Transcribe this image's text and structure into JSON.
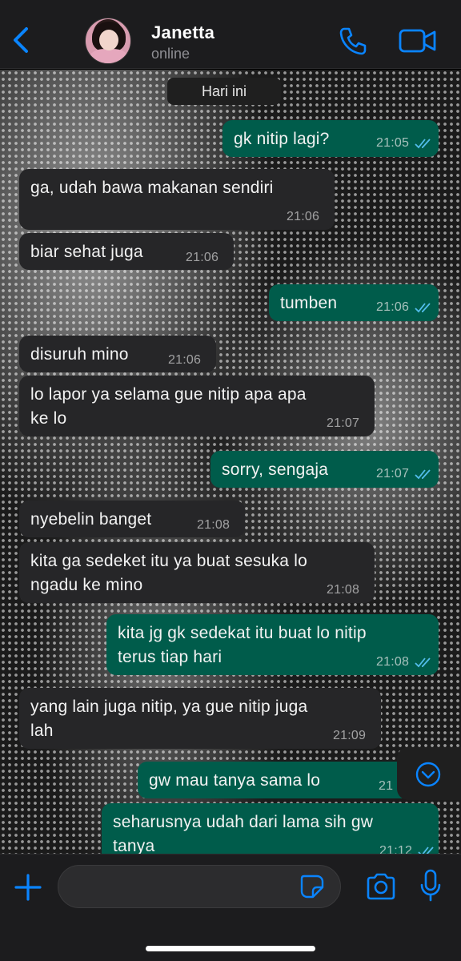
{
  "header": {
    "back_icon": "chevron-left-icon",
    "contact_name": "Janetta",
    "contact_status": "online",
    "call_icon": "phone-icon",
    "video_icon": "video-camera-icon",
    "accent_color": "#0a84ff"
  },
  "chat": {
    "date_label": "Hari ini",
    "messages": [
      {
        "direction": "out",
        "text": "gk nitip lagi?",
        "time": "21:05",
        "read": true
      },
      {
        "direction": "in",
        "text": "ga, udah bawa makanan sendiri",
        "time": "21:06"
      },
      {
        "direction": "in",
        "text": "biar sehat juga",
        "time": "21:06"
      },
      {
        "direction": "out",
        "text": "tumben",
        "time": "21:06",
        "read": true
      },
      {
        "direction": "in",
        "text": "disuruh mino",
        "time": "21:06"
      },
      {
        "direction": "in",
        "text": "lo lapor ya selama gue nitip apa apa\nke lo",
        "time": "21:07"
      },
      {
        "direction": "out",
        "text": "sorry, sengaja",
        "time": "21:07",
        "read": true
      },
      {
        "direction": "in",
        "text": "nyebelin banget",
        "time": "21:08"
      },
      {
        "direction": "in",
        "text": "kita ga sedeket itu ya buat sesuka lo\nngadu ke mino",
        "time": "21:08"
      },
      {
        "direction": "out",
        "text": "kita jg gk sedekat itu buat lo nitip\nterus tiap hari",
        "time": "21:08",
        "read": true
      },
      {
        "direction": "in",
        "text": "yang lain juga nitip, ya gue nitip juga\nlah",
        "time": "21:09"
      },
      {
        "direction": "out",
        "text": "gw mau tanya sama lo",
        "time": "21",
        "read": true
      },
      {
        "direction": "out",
        "text": "seharusnya udah dari lama sih gw\ntanya",
        "time": "21:12",
        "read": true
      }
    ],
    "outgoing_color": "#005c4b",
    "incoming_color": "#262628",
    "read_tick_color": "#53bdeb",
    "scroll_down_icon": "chevron-down-circle-icon"
  },
  "input_bar": {
    "plus_icon": "plus-icon",
    "message_placeholder": "",
    "sticker_icon": "sticker-icon",
    "camera_icon": "camera-icon",
    "mic_icon": "microphone-icon"
  }
}
